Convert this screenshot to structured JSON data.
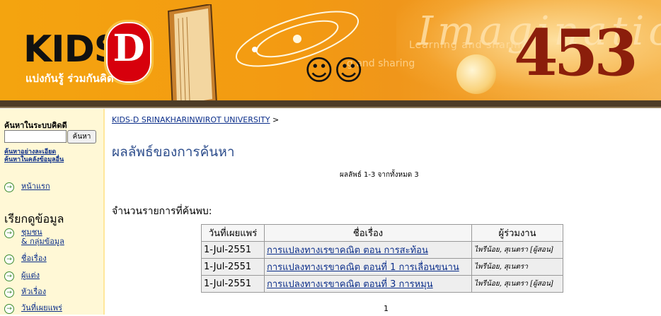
{
  "banner": {
    "logo_text": "KIDS",
    "logo_letter": "D",
    "tagline": "แบ่งกันรู้ ร่วมกันคิด",
    "imagine_text": "Imaginatio",
    "ghost_text_1": "Learning and sharing",
    "ghost_text_2": "g and sharing",
    "numbers_text": "453"
  },
  "sidebar": {
    "search_title": "ค้นหาในระบบคิดดี",
    "search_input_value": "",
    "search_button": "ค้นหา",
    "advanced_search_link": "ค้นหาอย่างละเอียด",
    "other_source_link": "ค้นหาในคลังข้อมูลอื่น",
    "home_link": "หน้าแรก",
    "browse_heading": "เรียกดูข้อมูล",
    "browse_items": [
      {
        "line1": "ชุมชน",
        "line2": "& กลุ่มข้อมูล"
      },
      {
        "line1": "ชื่อเรื่อง"
      },
      {
        "line1": "ผู้แต่ง"
      },
      {
        "line1": "หัวเรื่อง"
      },
      {
        "line1": "วันที่เผยแพร่"
      }
    ]
  },
  "main": {
    "breadcrumb_link": "KIDS-D SRINAKHARINWIROT UNIVERSITY",
    "breadcrumb_sep": ">",
    "page_title": "ผลลัพธ์ของการค้นหา",
    "result_summary": "ผลลัพธ์ 1-3 จากทั้งหมด 3",
    "count_heading": "จำนวนรายการที่ค้นพบ:",
    "table": {
      "headers": [
        "วันที่เผยแพร่",
        "ชื่อเรื่อง",
        "ผู้ร่วมงาน"
      ],
      "rows": [
        {
          "date": "1-Jul-2551",
          "title": "การแปลงทางเรขาคณิต ตอน การสะท้อน",
          "contributors": "ไพรีน้อย, สุเนตรา [ผู้สอน]"
        },
        {
          "date": "1-Jul-2551",
          "title": "การแปลงทางเรขาคณิต ตอนที่ 1 การเลื่อนขนาน",
          "contributors": "ไพรีน้อย, สุเนตรา"
        },
        {
          "date": "1-Jul-2551",
          "title": "การแปลงทางเรขาคณิต ตอนที่ 3 การหมุน",
          "contributors": "ไพรีน้อย, สุเนตรา [ผู้สอน]"
        }
      ]
    },
    "pager": "1"
  }
}
